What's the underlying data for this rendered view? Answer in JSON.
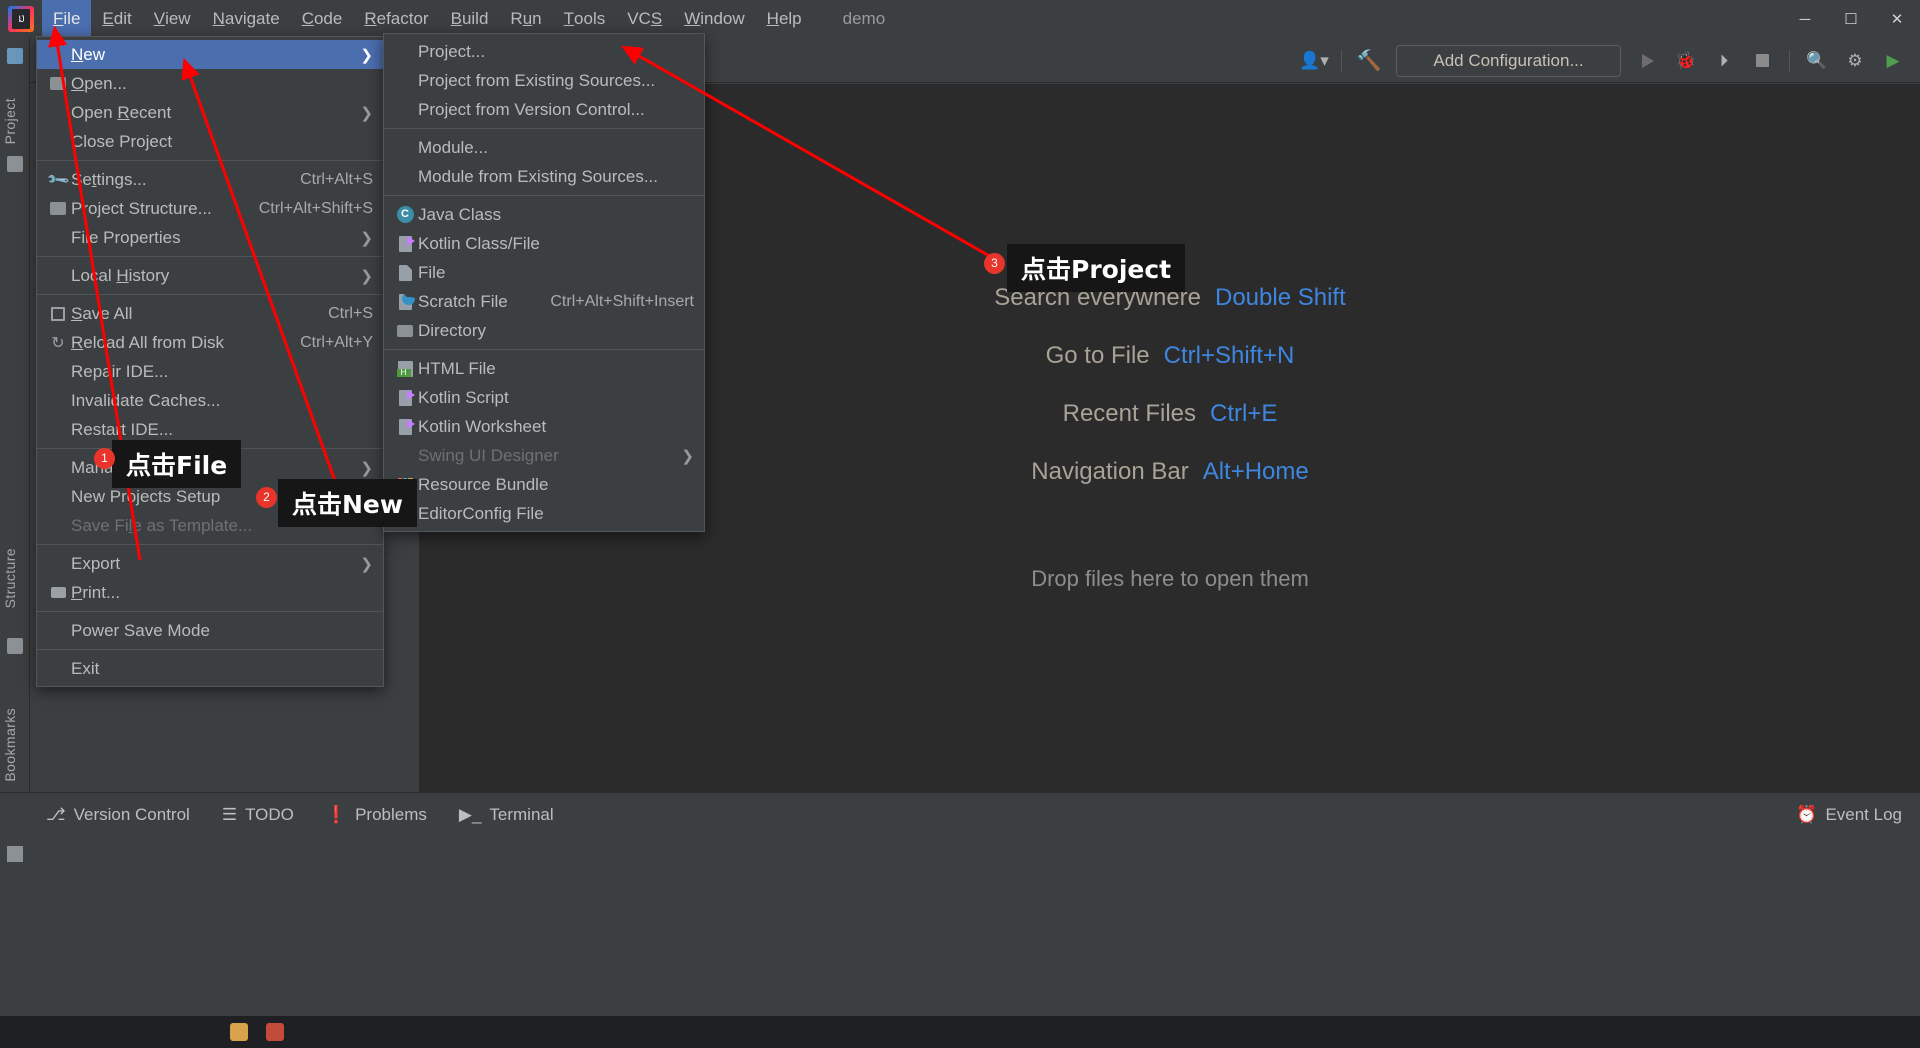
{
  "window": {
    "project_name": "demo",
    "controls": {
      "minimize": "─",
      "maximize": "☐",
      "close": "✕"
    }
  },
  "menubar": {
    "items": [
      {
        "label": "File",
        "mnemonic": "F",
        "active": true
      },
      {
        "label": "Edit",
        "mnemonic": "E",
        "active": false
      },
      {
        "label": "View",
        "mnemonic": "V",
        "active": false
      },
      {
        "label": "Navigate",
        "mnemonic": "N",
        "active": false
      },
      {
        "label": "Code",
        "mnemonic": "C",
        "active": false
      },
      {
        "label": "Refactor",
        "mnemonic": "R",
        "active": false
      },
      {
        "label": "Build",
        "mnemonic": "B",
        "active": false
      },
      {
        "label": "Run",
        "mnemonic": "u",
        "active": false
      },
      {
        "label": "Tools",
        "mnemonic": "T",
        "active": false
      },
      {
        "label": "VCS",
        "mnemonic": "S",
        "active": false
      },
      {
        "label": "Window",
        "mnemonic": "W",
        "active": false
      },
      {
        "label": "Help",
        "mnemonic": "H",
        "active": false
      }
    ]
  },
  "toolbar": {
    "add_configuration": "Add Configuration...",
    "icons": [
      "user-avatar-icon",
      "build-hammer-icon",
      "run-icon",
      "debug-icon",
      "run-coverage-icon",
      "stop-icon",
      "search-icon",
      "settings-gear-icon",
      "ide-assistant-icon"
    ]
  },
  "file_menu": {
    "groups": [
      [
        {
          "label": "New",
          "mnemonic": "N",
          "icon": "",
          "shortcut": "",
          "submenu": true,
          "selected": true,
          "disabled": false
        },
        {
          "label": "Open...",
          "mnemonic": "O",
          "icon": "open-folder-icon",
          "shortcut": "",
          "submenu": false,
          "selected": false,
          "disabled": false
        },
        {
          "label": "Open Recent",
          "mnemonic": "R",
          "icon": "",
          "shortcut": "",
          "submenu": true,
          "selected": false,
          "disabled": false
        },
        {
          "label": "Close Project",
          "mnemonic": "",
          "icon": "",
          "shortcut": "",
          "submenu": false,
          "selected": false,
          "disabled": false
        }
      ],
      [
        {
          "label": "Settings...",
          "mnemonic": "t",
          "icon": "wrench-icon",
          "shortcut": "Ctrl+Alt+S",
          "submenu": false,
          "selected": false,
          "disabled": false
        },
        {
          "label": "Project Structure...",
          "mnemonic": "",
          "icon": "project-structure-icon",
          "shortcut": "Ctrl+Alt+Shift+S",
          "submenu": false,
          "selected": false,
          "disabled": false
        },
        {
          "label": "File Properties",
          "mnemonic": "",
          "icon": "",
          "shortcut": "",
          "submenu": true,
          "selected": false,
          "disabled": false
        }
      ],
      [
        {
          "label": "Local History",
          "mnemonic": "H",
          "icon": "",
          "shortcut": "",
          "submenu": true,
          "selected": false,
          "disabled": false
        }
      ],
      [
        {
          "label": "Save All",
          "mnemonic": "S",
          "icon": "save-icon",
          "shortcut": "Ctrl+S",
          "submenu": false,
          "selected": false,
          "disabled": false
        },
        {
          "label": "Reload All from Disk",
          "mnemonic": "R",
          "icon": "reload-icon",
          "shortcut": "Ctrl+Alt+Y",
          "submenu": false,
          "selected": false,
          "disabled": false
        },
        {
          "label": "Repair IDE...",
          "mnemonic": "",
          "icon": "",
          "shortcut": "",
          "submenu": false,
          "selected": false,
          "disabled": false
        },
        {
          "label": "Invalidate Caches...",
          "mnemonic": "",
          "icon": "",
          "shortcut": "",
          "submenu": false,
          "selected": false,
          "disabled": false
        },
        {
          "label": "Restart IDE...",
          "mnemonic": "",
          "icon": "",
          "shortcut": "",
          "submenu": false,
          "selected": false,
          "disabled": false
        }
      ],
      [
        {
          "label": "Manage IDE Settings",
          "mnemonic": "",
          "icon": "",
          "shortcut": "",
          "submenu": true,
          "selected": false,
          "disabled": false
        },
        {
          "label": "New Projects Setup",
          "mnemonic": "",
          "icon": "",
          "shortcut": "",
          "submenu": true,
          "selected": false,
          "disabled": false
        },
        {
          "label": "Save File as Template...",
          "mnemonic": "l",
          "icon": "",
          "shortcut": "",
          "submenu": false,
          "selected": false,
          "disabled": true
        }
      ],
      [
        {
          "label": "Export",
          "mnemonic": "",
          "icon": "",
          "shortcut": "",
          "submenu": true,
          "selected": false,
          "disabled": false
        },
        {
          "label": "Print...",
          "mnemonic": "P",
          "icon": "print-icon",
          "shortcut": "",
          "submenu": false,
          "selected": false,
          "disabled": false
        }
      ],
      [
        {
          "label": "Power Save Mode",
          "mnemonic": "",
          "icon": "",
          "shortcut": "",
          "submenu": false,
          "selected": false,
          "disabled": false
        }
      ],
      [
        {
          "label": "Exit",
          "mnemonic": "",
          "icon": "",
          "shortcut": "",
          "submenu": false,
          "selected": false,
          "disabled": false
        }
      ]
    ]
  },
  "new_menu": {
    "groups": [
      [
        {
          "label": "Project...",
          "icon": "",
          "shortcut": "",
          "submenu": false,
          "disabled": false
        },
        {
          "label": "Project from Existing Sources...",
          "icon": "",
          "shortcut": "",
          "submenu": false,
          "disabled": false
        },
        {
          "label": "Project from Version Control...",
          "icon": "",
          "shortcut": "",
          "submenu": false,
          "disabled": false
        }
      ],
      [
        {
          "label": "Module...",
          "icon": "",
          "shortcut": "",
          "submenu": false,
          "disabled": false
        },
        {
          "label": "Module from Existing Sources...",
          "icon": "",
          "shortcut": "",
          "submenu": false,
          "disabled": false
        }
      ],
      [
        {
          "label": "Java Class",
          "icon": "java-class-icon",
          "shortcut": "",
          "submenu": false,
          "disabled": false
        },
        {
          "label": "Kotlin Class/File",
          "icon": "kotlin-file-icon",
          "shortcut": "",
          "submenu": false,
          "disabled": false
        },
        {
          "label": "File",
          "icon": "file-icon",
          "shortcut": "",
          "submenu": false,
          "disabled": false
        },
        {
          "label": "Scratch File",
          "icon": "scratch-file-icon",
          "shortcut": "Ctrl+Alt+Shift+Insert",
          "submenu": false,
          "disabled": false
        },
        {
          "label": "Directory",
          "icon": "directory-icon",
          "shortcut": "",
          "submenu": false,
          "disabled": false
        }
      ],
      [
        {
          "label": "HTML File",
          "icon": "html-file-icon",
          "shortcut": "",
          "submenu": false,
          "disabled": false
        },
        {
          "label": "Kotlin Script",
          "icon": "kotlin-script-icon",
          "shortcut": "",
          "submenu": false,
          "disabled": false
        },
        {
          "label": "Kotlin Worksheet",
          "icon": "kotlin-worksheet-icon",
          "shortcut": "",
          "submenu": false,
          "disabled": false
        },
        {
          "label": "Swing UI Designer",
          "icon": "",
          "shortcut": "",
          "submenu": true,
          "disabled": true
        },
        {
          "label": "Resource Bundle",
          "icon": "resource-bundle-icon",
          "shortcut": "",
          "submenu": false,
          "disabled": false
        },
        {
          "label": "EditorConfig File",
          "icon": "editorconfig-icon",
          "shortcut": "",
          "submenu": false,
          "disabled": false
        }
      ]
    ]
  },
  "left_strip": {
    "tabs": [
      "Project",
      "Structure",
      "Bookmarks"
    ]
  },
  "editor": {
    "welcome_rows": [
      {
        "text": "Search everywhere",
        "key": "Double Shift"
      },
      {
        "text": "Go to File",
        "key": "Ctrl+Shift+N"
      },
      {
        "text": "Recent Files",
        "key": "Ctrl+E"
      },
      {
        "text": "Navigation Bar",
        "key": "Alt+Home"
      }
    ],
    "drop_hint": "Drop files here to open them"
  },
  "statusbar": {
    "items": [
      {
        "label": "Version Control",
        "icon": "vcs-branch-icon"
      },
      {
        "label": "TODO",
        "icon": "todo-list-icon"
      },
      {
        "label": "Problems",
        "icon": "problems-icon"
      },
      {
        "label": "Terminal",
        "icon": "terminal-icon"
      }
    ],
    "event_log": "Event Log"
  },
  "annotations": [
    {
      "number": "1",
      "label": "点击File"
    },
    {
      "number": "2",
      "label": "点击New"
    },
    {
      "number": "3",
      "label": "点击Project"
    }
  ],
  "colors": {
    "accent_selection": "#4b6eaf",
    "annotation_red": "#ff0000",
    "badge_red": "#e8342a",
    "link_blue": "#3e86e0",
    "bg_panel": "#3c3f41",
    "bg_editor": "#2b2b2b"
  }
}
